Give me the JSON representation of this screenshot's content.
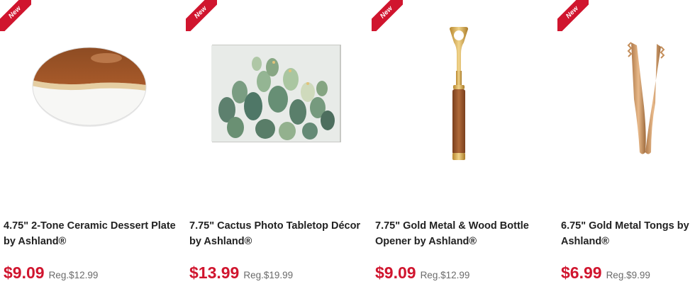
{
  "products": [
    {
      "badge": "New",
      "title": "4.75\" 2-Tone Ceramic Dessert Plate by Ashland®",
      "sale_price": "$9.09",
      "reg_price": "Reg.$12.99"
    },
    {
      "badge": "New",
      "title": "7.75\" Cactus Photo Tabletop Décor by Ashland®",
      "sale_price": "$13.99",
      "reg_price": "Reg.$19.99"
    },
    {
      "badge": "New",
      "title": "7.75\" Gold Metal & Wood Bottle Opener by Ashland®",
      "sale_price": "$9.09",
      "reg_price": "Reg.$12.99"
    },
    {
      "badge": "New",
      "title": "6.75\" Gold Metal Tongs by Ashland®",
      "sale_price": "$6.99",
      "reg_price": "Reg.$9.99"
    }
  ],
  "colors": {
    "accent": "#d0152e",
    "text": "#222222",
    "muted": "#6b6b6b"
  }
}
